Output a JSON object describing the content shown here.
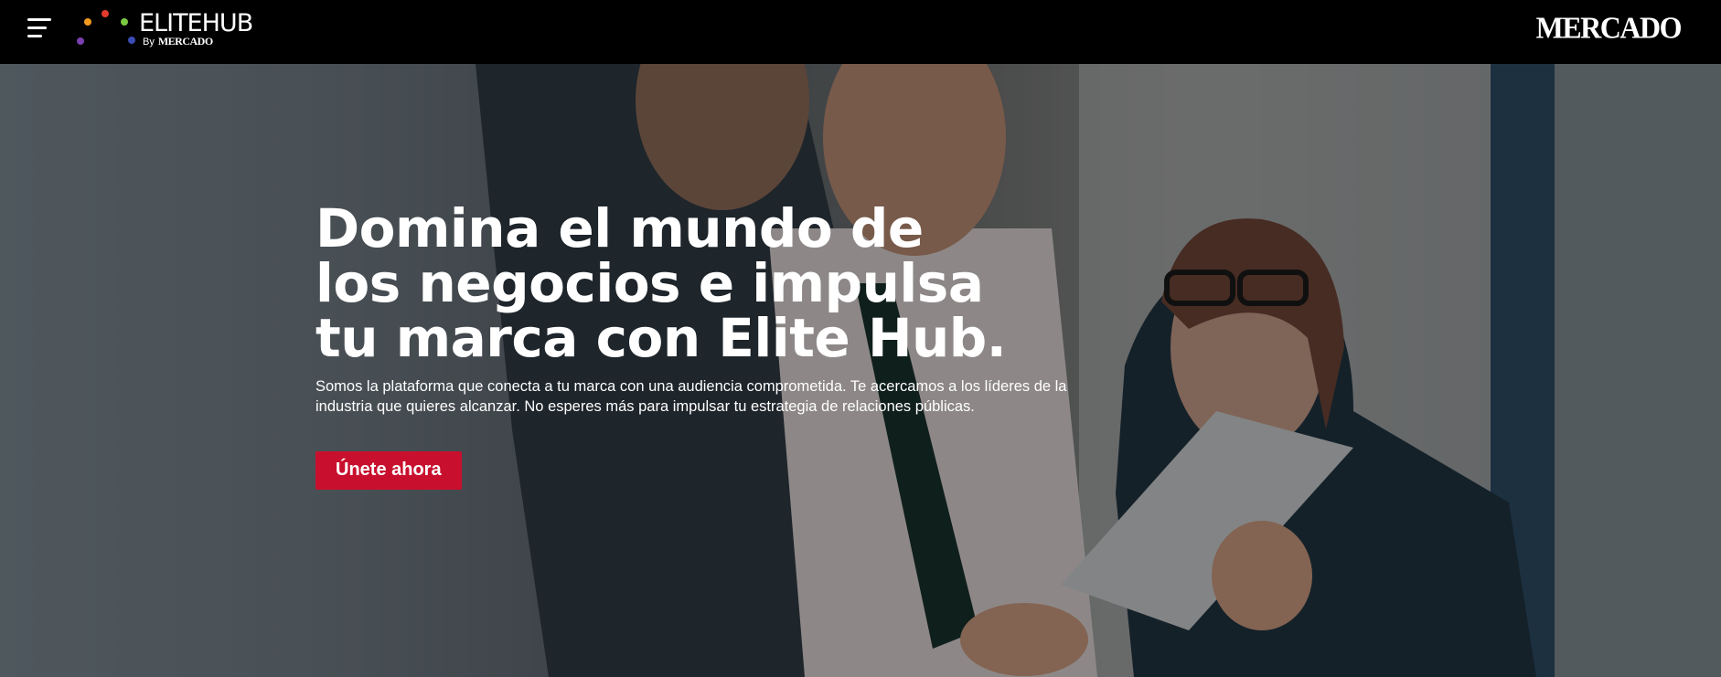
{
  "header": {
    "menu_icon": "hamburger-menu-icon",
    "logo": {
      "name_part1": "ELITE",
      "name_part2": "HUB",
      "by": "By",
      "by_brand": "MERCADO",
      "dot_colors": [
        "#e23b2e",
        "#f39a1e",
        "#7ac943",
        "#7b3fb0",
        "#3b4bb5"
      ]
    },
    "partner_logo": "MERCADO"
  },
  "hero": {
    "title": "Domina el mundo de los negocios e impulsa tu marca con Elite Hub.",
    "description": "Somos la plataforma que conecta a tu marca con una audiencia comprometida. Te acercamos a los líderes de la industria que quieres alcanzar. No esperes más para impulsar tu estrategia de relaciones públicas.",
    "cta_label": "Únete ahora",
    "cta_color": "#c8102e"
  }
}
